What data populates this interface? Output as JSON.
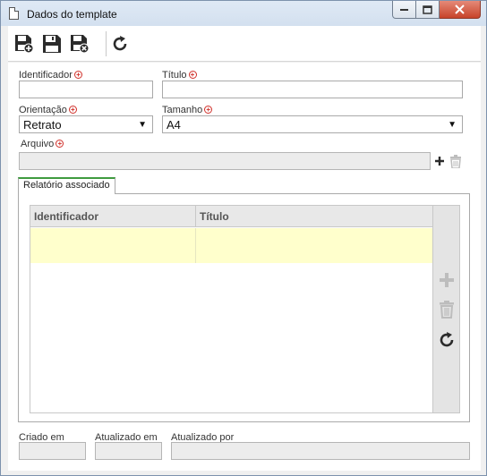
{
  "window": {
    "title": "Dados do template",
    "controls": {
      "minimize": "▭",
      "maximize": "□",
      "close": "✕"
    }
  },
  "toolbar": {
    "buttons": [
      {
        "name": "save-new-button",
        "icon": "floppy-plus-icon"
      },
      {
        "name": "save-button",
        "icon": "floppy-icon"
      },
      {
        "name": "save-close-button",
        "icon": "floppy-close-icon"
      },
      {
        "name": "refresh-button",
        "icon": "refresh-icon"
      }
    ]
  },
  "form": {
    "identificador": {
      "label": "Identificador",
      "value": "",
      "required": true
    },
    "titulo": {
      "label": "Título",
      "value": "",
      "required": true
    },
    "orientacao": {
      "label": "Orientação",
      "value": "Retrato",
      "required": true
    },
    "tamanho": {
      "label": "Tamanho",
      "value": "A4",
      "required": true
    },
    "arquivo": {
      "label": "Arquivo",
      "value": "",
      "required": true
    }
  },
  "tabs": [
    {
      "label": "Relatório associado",
      "active": true
    }
  ],
  "grid": {
    "columns": [
      "Identificador",
      "Título"
    ],
    "rows": [
      [
        "",
        ""
      ]
    ]
  },
  "footer": {
    "criado_em": {
      "label": "Criado em",
      "value": ""
    },
    "atualizado_em": {
      "label": "Atualizado em",
      "value": ""
    },
    "atualizado_por": {
      "label": "Atualizado por",
      "value": ""
    }
  },
  "colors": {
    "required": "#d0302a",
    "selected_row": "#ffffcc",
    "tab_accent": "#3f9b3f",
    "icon_dark": "#2b2b2b",
    "icon_disabled": "#bdbdbd"
  }
}
